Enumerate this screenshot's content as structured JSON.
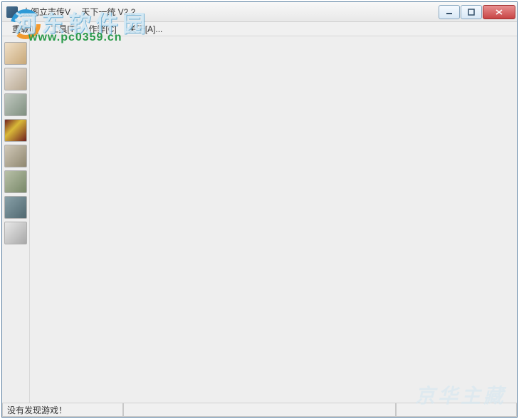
{
  "window": {
    "title": "太阁立志传V　 天下一统 V2.2"
  },
  "menu": {
    "items": [
      {
        "label": "重载[L]"
      },
      {
        "label": "工具[T]"
      },
      {
        "label": "作弊[C]"
      },
      {
        "label": "关于[A]..."
      }
    ]
  },
  "sidebar": {
    "items": [
      {
        "name": "character-1"
      },
      {
        "name": "character-2"
      },
      {
        "name": "scene-sea"
      },
      {
        "name": "crown-item"
      },
      {
        "name": "scene-field"
      },
      {
        "name": "scene-forest"
      },
      {
        "name": "character-3"
      },
      {
        "name": "character-4"
      }
    ]
  },
  "status": {
    "message": "没有发现游戏！"
  },
  "watermarks": {
    "top_text": "河东软件园",
    "url": "www.pc0359.cn",
    "bottom_text": "京华主藏"
  }
}
